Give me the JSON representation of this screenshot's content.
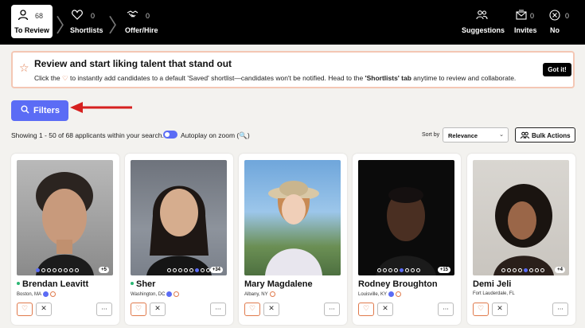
{
  "nav": {
    "to_review": {
      "label": "To Review",
      "count": "68",
      "icon": "person-icon"
    },
    "shortlists": {
      "label": "Shortlists",
      "count": "0",
      "icon": "heart-icon"
    },
    "offer_hire": {
      "label": "Offer/Hire",
      "count": "0",
      "icon": "handshake-icon"
    },
    "suggestions": {
      "label": "Suggestions",
      "icon": "people-icon"
    },
    "invites": {
      "label": "Invites",
      "count": "0",
      "icon": "envelope-icon"
    },
    "no": {
      "label": "No",
      "count": "0",
      "icon": "close-circle-icon"
    }
  },
  "banner": {
    "title": "Review and start liking talent that stand out",
    "sub_before": "Click the",
    "sub_after": "to instantly add candidates to a default 'Saved' shortlist—candidates won't be notified. Head to the ",
    "sub_bold": "'Shortlists' tab",
    "sub_end": " anytime to review and collaborate.",
    "button": "Got it!"
  },
  "filters": {
    "label": "Filters"
  },
  "results": {
    "showing": "Showing 1 - 50 of 68 applicants within your search.",
    "autoplay": "Autoplay on zoom (🔍)"
  },
  "sort": {
    "label": "Sort by",
    "value": "Relevance"
  },
  "bulk": {
    "label": "Bulk Actions"
  },
  "colors": {
    "accent": "#5b6cf5",
    "heart": "#e07a4c",
    "topbar": "#000000"
  },
  "candidates": [
    {
      "name": "Brendan Leavitt",
      "location": "Boston, MA",
      "badge": "+5",
      "online": true
    },
    {
      "name": "Sher",
      "location": "Washington, DC",
      "badge": "+34",
      "online": true
    },
    {
      "name": "Mary Magdalene",
      "location": "Albany, NY",
      "badge": "",
      "online": false
    },
    {
      "name": "Rodney Broughton",
      "location": "Louisville, KY",
      "badge": "+15",
      "online": false
    },
    {
      "name": "Demi Jeli",
      "location": "Fort Lauderdale, FL",
      "badge": "+4",
      "online": false
    }
  ]
}
